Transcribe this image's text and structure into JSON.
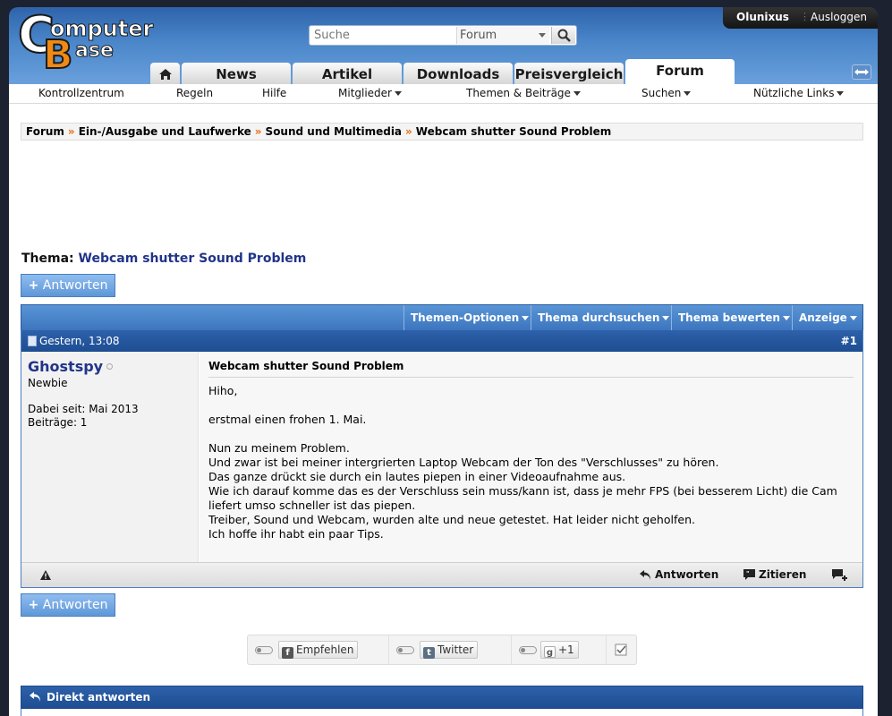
{
  "header": {
    "logo_text": "ComputerBase",
    "search": {
      "placeholder": "Suche",
      "scope": "Forum"
    },
    "user": {
      "name": "Olunixus",
      "logout": "Ausloggen"
    },
    "tabs": [
      {
        "label": "News"
      },
      {
        "label": "Artikel"
      },
      {
        "label": "Downloads"
      },
      {
        "label": "Preisvergleich"
      },
      {
        "label": "Forum",
        "active": true
      }
    ]
  },
  "subnav": [
    {
      "label": "Kontrollzentrum"
    },
    {
      "label": "Regeln"
    },
    {
      "label": "Hilfe"
    },
    {
      "label": "Mitglieder"
    },
    {
      "label": "Themen & Beiträge"
    },
    {
      "label": "Suchen"
    },
    {
      "label": "Nützliche Links"
    }
  ],
  "breadcrumb": [
    "Forum",
    "Ein-/Ausgabe und Laufwerke",
    "Sound und Multimedia",
    "Webcam shutter Sound Problem"
  ],
  "breadcrumb_sep": "»",
  "thread": {
    "label": "Thema:",
    "title": "Webcam shutter Sound Problem",
    "reply_label": "Antworten",
    "tools": [
      "Themen-Optionen",
      "Thema durchsuchen",
      "Thema bewerten",
      "Anzeige"
    ]
  },
  "post": {
    "date": "Gestern, 13:08",
    "number": "#1",
    "author": {
      "name": "Ghostspy",
      "title": "Newbie",
      "joined": "Dabei seit: Mai 2013",
      "posts": "Beiträge: 1"
    },
    "subject": "Webcam shutter Sound Problem",
    "lines": [
      "Hiho,",
      "",
      "erstmal einen frohen 1. Mai.",
      "",
      "Nun zu meinem Problem.",
      "Und zwar ist bei meiner intergrierten Laptop Webcam der Ton des \"Verschlusses\" zu hören.",
      "Das ganze drückt sie durch ein lautes piepen in einer Videoaufnahme aus.",
      "Wie ich darauf komme das es der Verschluss sein muss/kann ist, dass je mehr FPS (bei besserem Licht) die Cam",
      "liefert umso schneller ist das piepen.",
      "Treiber, Sound und Webcam, wurden alte und neue getestet. Hat leider nicht geholfen.",
      "Ich hoffe ihr habt ein paar Tips."
    ],
    "actions": {
      "reply": "Antworten",
      "quote": "Zitieren"
    }
  },
  "social": {
    "facebook": "Empfehlen",
    "twitter": "Twitter",
    "google": "+1"
  },
  "quick_reply": {
    "label": "Direkt antworten"
  }
}
